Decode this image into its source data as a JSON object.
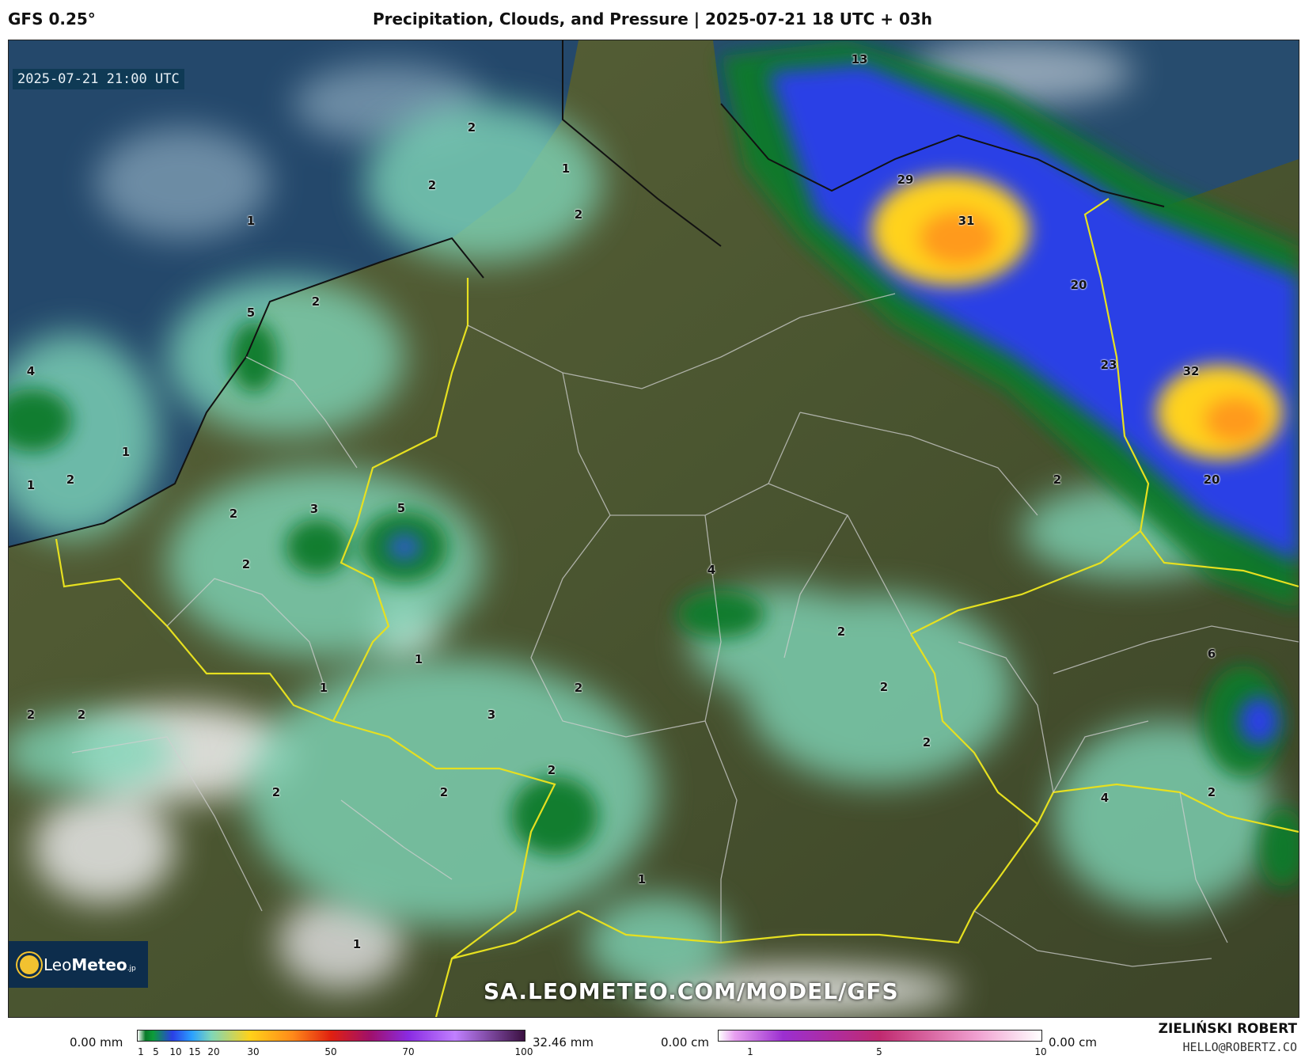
{
  "header": {
    "model": "GFS 0.25°",
    "title": "Precipitation, Clouds, and Pressure | 2025-07-21 18 UTC + 03h"
  },
  "map": {
    "timestamp": "2025-07-21 21:00 UTC",
    "watermark": "SA.LEOMETEO.COM/MODEL/GFS",
    "logo": {
      "name_light": "Leo",
      "name_bold": "Meteo",
      "suffix": ".jp"
    },
    "precip_labels": [
      "13",
      "2",
      "1",
      "2",
      "2",
      "1",
      "29",
      "31",
      "5",
      "2",
      "20",
      "4",
      "23",
      "32",
      "1",
      "2",
      "1",
      "3",
      "5",
      "2",
      "2",
      "20",
      "4",
      "2",
      "2",
      "6",
      "1",
      "1",
      "2",
      "2",
      "2",
      "2",
      "3",
      "2",
      "2",
      "2",
      "4",
      "2",
      "2",
      "1",
      "1"
    ]
  },
  "legend": {
    "precip": {
      "min_label": "0.00 mm",
      "max_label": "32.46 mm",
      "ticks": [
        "1",
        "5",
        "10",
        "15",
        "20",
        "30",
        "50",
        "70",
        "100"
      ]
    },
    "snow": {
      "min_label": "0.00 cm",
      "max_label": "0.00 cm",
      "ticks": [
        "1",
        "5",
        "10"
      ]
    }
  },
  "credit": {
    "author": "ZIELIŃSKI ROBERT",
    "email": "HELLO@ROBERTZ.CO"
  },
  "colors": {
    "precip_light": "#7fd6b8",
    "precip_green": "#0a7a2a",
    "precip_blue": "#2a3fe6",
    "precip_yellow": "#ffd21a",
    "precip_orange": "#ff9a1a",
    "border_yellow": "#e6e020",
    "sea": "#24486b",
    "land": "#4a5530"
  }
}
